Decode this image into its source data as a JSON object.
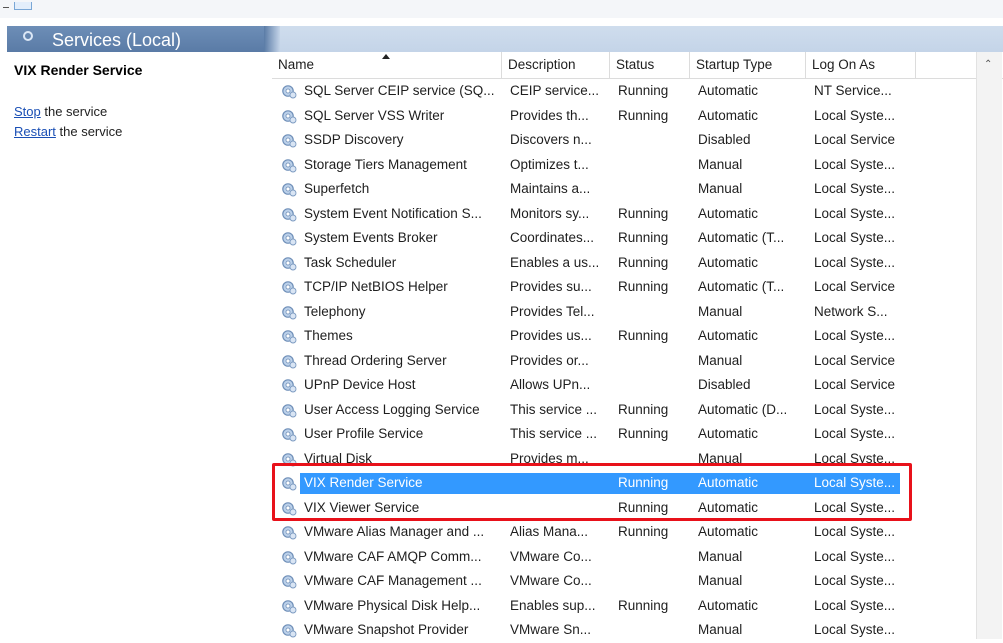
{
  "header": {
    "title": "Services (Local)"
  },
  "left_pane": {
    "service_name": "VIX Render Service",
    "actions": [
      {
        "link": "Stop",
        "text": " the service"
      },
      {
        "link": "Restart",
        "text": " the service"
      }
    ]
  },
  "columns": [
    "Name",
    "Description",
    "Status",
    "Startup Type",
    "Log On As"
  ],
  "rows": [
    {
      "name": "SQL Server CEIP service (SQ...",
      "description": "CEIP service...",
      "status": "Running",
      "startup": "Automatic",
      "logon": "NT Service..."
    },
    {
      "name": "SQL Server VSS Writer",
      "description": "Provides th...",
      "status": "Running",
      "startup": "Automatic",
      "logon": "Local Syste..."
    },
    {
      "name": "SSDP Discovery",
      "description": "Discovers n...",
      "status": "",
      "startup": "Disabled",
      "logon": "Local Service"
    },
    {
      "name": "Storage Tiers Management",
      "description": "Optimizes t...",
      "status": "",
      "startup": "Manual",
      "logon": "Local Syste..."
    },
    {
      "name": "Superfetch",
      "description": "Maintains a...",
      "status": "",
      "startup": "Manual",
      "logon": "Local Syste..."
    },
    {
      "name": "System Event Notification S...",
      "description": "Monitors sy...",
      "status": "Running",
      "startup": "Automatic",
      "logon": "Local Syste..."
    },
    {
      "name": "System Events Broker",
      "description": "Coordinates...",
      "status": "Running",
      "startup": "Automatic (T...",
      "logon": "Local Syste..."
    },
    {
      "name": "Task Scheduler",
      "description": "Enables a us...",
      "status": "Running",
      "startup": "Automatic",
      "logon": "Local Syste..."
    },
    {
      "name": "TCP/IP NetBIOS Helper",
      "description": "Provides su...",
      "status": "Running",
      "startup": "Automatic (T...",
      "logon": "Local Service"
    },
    {
      "name": "Telephony",
      "description": "Provides Tel...",
      "status": "",
      "startup": "Manual",
      "logon": "Network S..."
    },
    {
      "name": "Themes",
      "description": "Provides us...",
      "status": "Running",
      "startup": "Automatic",
      "logon": "Local Syste..."
    },
    {
      "name": "Thread Ordering Server",
      "description": "Provides or...",
      "status": "",
      "startup": "Manual",
      "logon": "Local Service"
    },
    {
      "name": "UPnP Device Host",
      "description": "Allows UPn...",
      "status": "",
      "startup": "Disabled",
      "logon": "Local Service"
    },
    {
      "name": "User Access Logging Service",
      "description": "This service ...",
      "status": "Running",
      "startup": "Automatic (D...",
      "logon": "Local Syste..."
    },
    {
      "name": "User Profile Service",
      "description": "This service ...",
      "status": "Running",
      "startup": "Automatic",
      "logon": "Local Syste..."
    },
    {
      "name": "Virtual Disk",
      "description": "Provides m...",
      "status": "",
      "startup": "Manual",
      "logon": "Local Syste..."
    },
    {
      "name": "VIX Render Service",
      "description": "",
      "status": "Running",
      "startup": "Automatic",
      "logon": "Local Syste...",
      "selected": true
    },
    {
      "name": "VIX Viewer Service",
      "description": "",
      "status": "Running",
      "startup": "Automatic",
      "logon": "Local Syste..."
    },
    {
      "name": "VMware Alias Manager and ...",
      "description": "Alias Mana...",
      "status": "Running",
      "startup": "Automatic",
      "logon": "Local Syste..."
    },
    {
      "name": "VMware CAF AMQP Comm...",
      "description": "VMware Co...",
      "status": "",
      "startup": "Manual",
      "logon": "Local Syste..."
    },
    {
      "name": "VMware CAF Management ...",
      "description": "VMware Co...",
      "status": "",
      "startup": "Manual",
      "logon": "Local Syste..."
    },
    {
      "name": "VMware Physical Disk Help...",
      "description": "Enables sup...",
      "status": "Running",
      "startup": "Automatic",
      "logon": "Local Syste..."
    },
    {
      "name": "VMware Snapshot Provider",
      "description": "VMware Sn...",
      "status": "",
      "startup": "Manual",
      "logon": "Local Syste..."
    }
  ],
  "colors": {
    "selection": "#3399ff",
    "highlight_box": "#e8111a",
    "link": "#1a4fb5"
  },
  "icons": {
    "service_row": "gear-icon",
    "header": "services-icon"
  }
}
